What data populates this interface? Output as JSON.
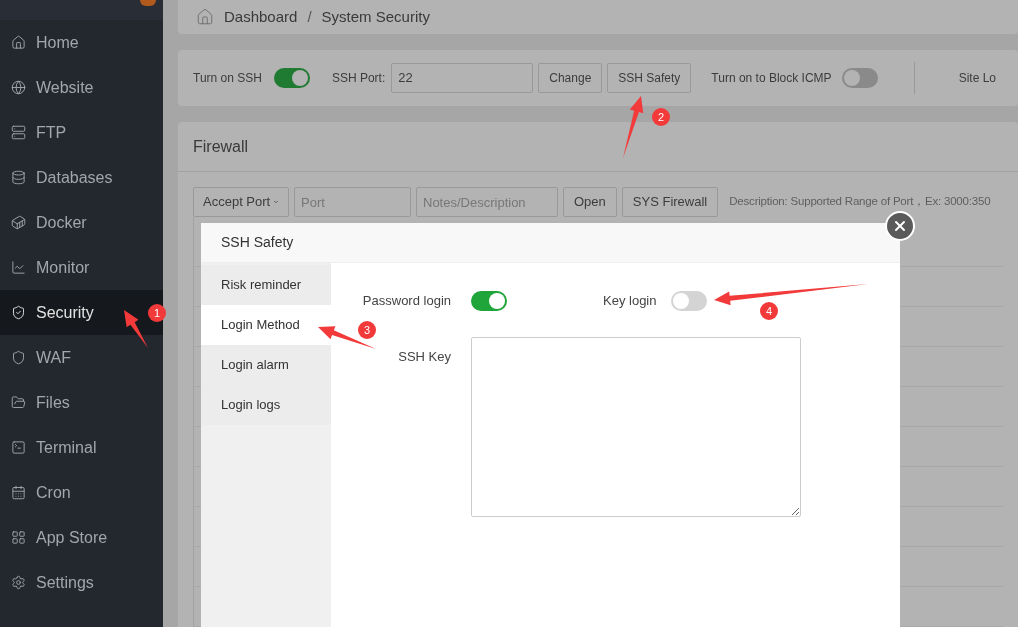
{
  "breadcrumb": [
    {
      "label": "Dashboard"
    },
    {
      "label": "System Security"
    }
  ],
  "breadcrumb_separator": "/",
  "sidebar": {
    "items": [
      {
        "label": "Home",
        "selected": false
      },
      {
        "label": "Website",
        "selected": false
      },
      {
        "label": "FTP",
        "selected": false
      },
      {
        "label": "Databases",
        "selected": false
      },
      {
        "label": "Docker",
        "selected": false
      },
      {
        "label": "Monitor",
        "selected": false
      },
      {
        "label": "Security",
        "selected": true
      },
      {
        "label": "WAF",
        "selected": false
      },
      {
        "label": "Files",
        "selected": false
      },
      {
        "label": "Terminal",
        "selected": false
      },
      {
        "label": "Cron",
        "selected": false
      },
      {
        "label": "App Store",
        "selected": false
      },
      {
        "label": "Settings",
        "selected": false
      }
    ]
  },
  "ssh_bar": {
    "ssh_toggle": {
      "label": "Turn on SSH",
      "on": true
    },
    "port_label": "SSH Port:",
    "port_value": "22",
    "buttons": [
      "Change",
      "SSH Safety"
    ],
    "icmp_toggle": {
      "label": "Turn on to Block ICMP",
      "on": false
    },
    "column_3": "Site Lo"
  },
  "firewall": {
    "title": "Firewall",
    "select": "Accept Port",
    "port_placeholder": "Port",
    "notes_placeholder": "Notes/Description",
    "buttons": [
      "Open",
      "SYS Firewall"
    ],
    "description": "Description: Supported Range of Port，Ex: 3000:350"
  },
  "dialog": {
    "title": "SSH Safety",
    "tabs": [
      {
        "label": "Risk reminder",
        "selected": false
      },
      {
        "label": "Login Method",
        "selected": true
      },
      {
        "label": "Login alarm",
        "selected": false
      },
      {
        "label": "Login logs",
        "selected": false
      }
    ],
    "password_toggle": {
      "label": "Password login",
      "on": true
    },
    "key_toggle": {
      "label": "Key login",
      "on": false
    },
    "ssh_key_label": "SSH Key"
  },
  "annotations": [
    {
      "number": "1"
    },
    {
      "number": "2"
    },
    {
      "number": "3"
    },
    {
      "number": "4"
    }
  ]
}
